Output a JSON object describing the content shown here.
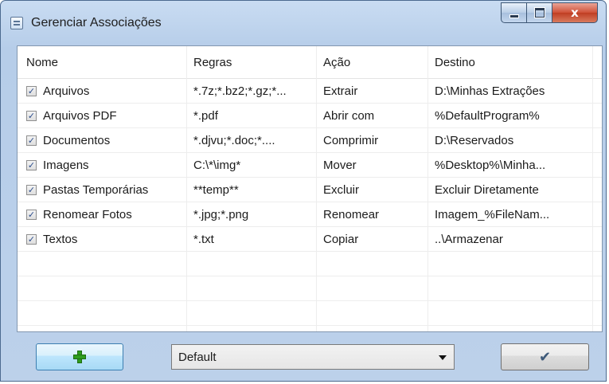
{
  "window": {
    "title": "Gerenciar Associações",
    "icon": "list-icon",
    "controls": [
      "minimize-icon",
      "maximize-icon",
      "close-icon"
    ],
    "close_glyph": "x"
  },
  "table": {
    "columns": [
      "Nome",
      "Regras",
      "Ação",
      "Destino"
    ],
    "rows": [
      {
        "checked": true,
        "nome": "Arquivos",
        "regras": "*.7z;*.bz2;*.gz;*...",
        "acao": "Extrair",
        "destino": "D:\\Minhas Extrações"
      },
      {
        "checked": true,
        "nome": "Arquivos PDF",
        "regras": "*.pdf",
        "acao": "Abrir com",
        "destino": "%DefaultProgram%"
      },
      {
        "checked": true,
        "nome": "Documentos",
        "regras": "*.djvu;*.doc;*....",
        "acao": "Comprimir",
        "destino": "D:\\Reservados"
      },
      {
        "checked": true,
        "nome": "Imagens",
        "regras": "C:\\*\\img*",
        "acao": "Mover",
        "destino": "%Desktop%\\Minha..."
      },
      {
        "checked": true,
        "nome": "Pastas Temporárias",
        "regras": "**temp**",
        "acao": "Excluir",
        "destino": "Excluir Diretamente"
      },
      {
        "checked": true,
        "nome": "Renomear Fotos",
        "regras": "*.jpg;*.png",
        "acao": "Renomear",
        "destino": "Imagem_%FileNam..."
      },
      {
        "checked": true,
        "nome": "Textos",
        "regras": "*.txt",
        "acao": "Copiar",
        "destino": "..\\Armazenar"
      }
    ]
  },
  "bottom": {
    "add_button_icon": "plus-icon",
    "profile_select": {
      "value": "Default"
    },
    "ok_button_icon": "check-icon"
  },
  "colors": {
    "add_icon": "#2f9d1d",
    "close_button": "#c03d22",
    "checkbox_mark": "#2b4d8c"
  }
}
